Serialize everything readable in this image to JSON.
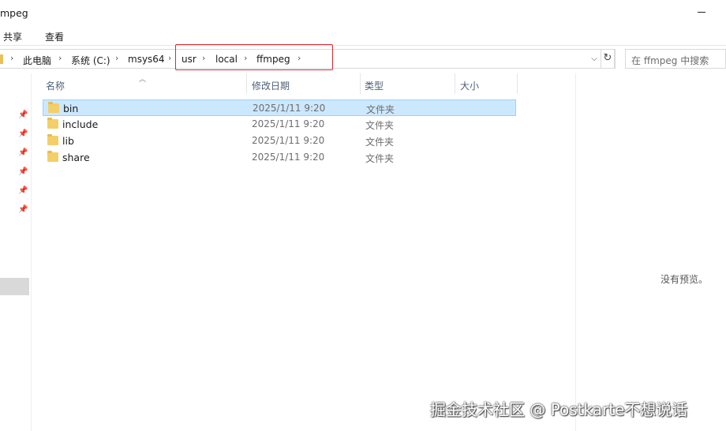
{
  "window": {
    "title": "mpeg"
  },
  "ribbon": {
    "tabs": [
      "共享",
      "查看"
    ]
  },
  "address": {
    "crumbs": [
      "此电脑",
      "系统 (C:)",
      "msys64",
      "usr",
      "local",
      "ffmpeg"
    ],
    "separator": "›",
    "dropdown_icon": "chevron-down-icon",
    "refresh_icon": "refresh-icon"
  },
  "search": {
    "placeholder": "在 ffmpeg 中搜索"
  },
  "columns": {
    "name": "名称",
    "modified": "修改日期",
    "type": "类型",
    "size": "大小"
  },
  "files": [
    {
      "name": "bin",
      "modified": "2025/1/11 9:20",
      "type": "文件夹",
      "selected": true
    },
    {
      "name": "include",
      "modified": "2025/1/11 9:20",
      "type": "文件夹",
      "selected": false
    },
    {
      "name": "lib",
      "modified": "2025/1/11 9:20",
      "type": "文件夹",
      "selected": false
    },
    {
      "name": "share",
      "modified": "2025/1/11 9:20",
      "type": "文件夹",
      "selected": false
    }
  ],
  "preview": {
    "empty_text": "没有预览。"
  },
  "watermark": "掘金技术社区 @ Postkarte不想说话",
  "colors": {
    "selection": "#cce8ff",
    "highlight_box": "#e0242b",
    "folder": "#f3cf6a"
  }
}
